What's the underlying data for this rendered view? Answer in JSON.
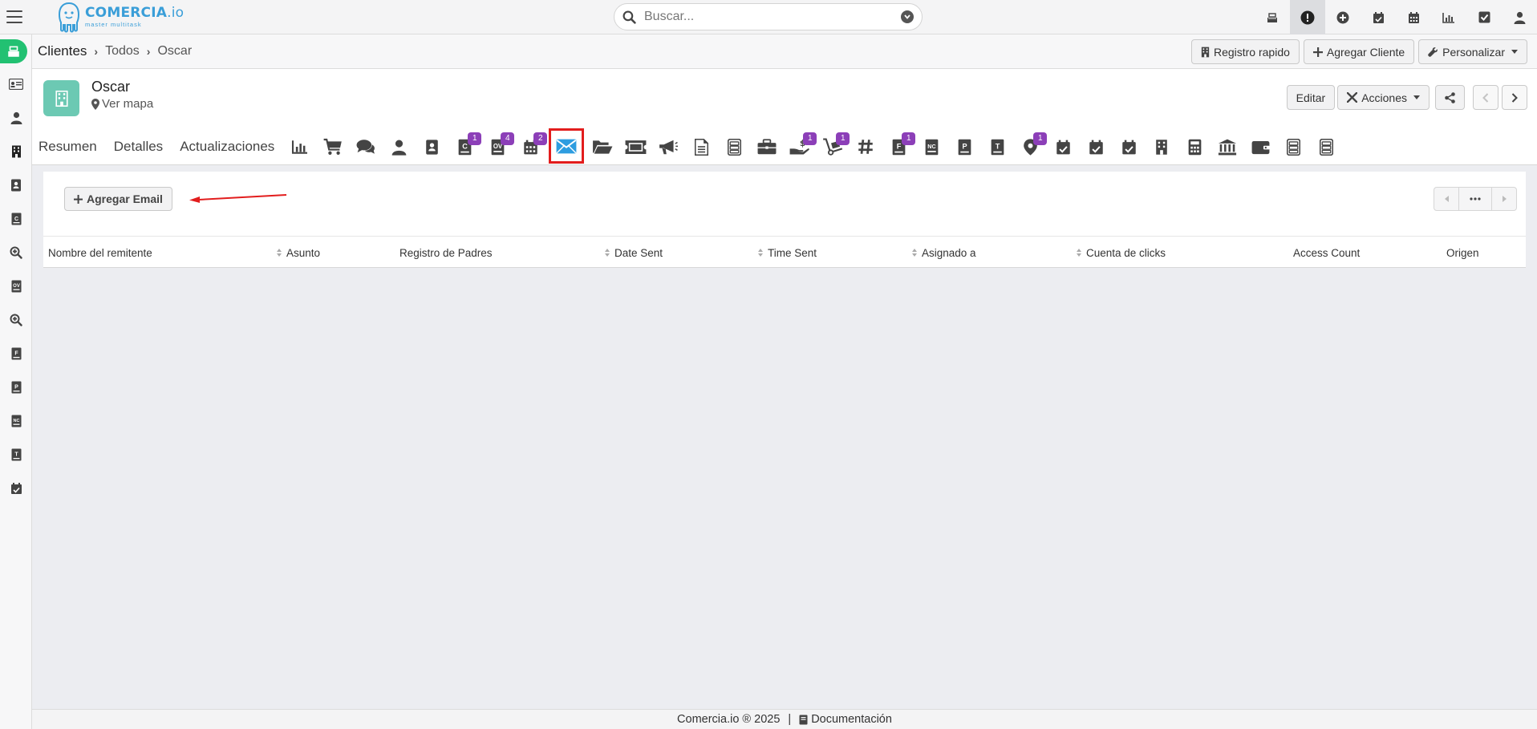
{
  "app": {
    "logo_name": "COMERCIA",
    "logo_ext": ".io",
    "logo_tagline": "master multitask"
  },
  "search": {
    "placeholder": "Buscar..."
  },
  "breadcrumb": {
    "level1": "Clientes",
    "level2": "Todos",
    "level3": "Oscar"
  },
  "header_actions": {
    "quick_register": "Registro rapido",
    "add_client": "Agregar Cliente",
    "customize": "Personalizar"
  },
  "record": {
    "name": "Oscar",
    "map_link": "Ver mapa",
    "edit": "Editar",
    "actions": "Acciones"
  },
  "tabs": {
    "summary": "Resumen",
    "details": "Detalles",
    "updates": "Actualizaciones"
  },
  "tab_icons": [
    {
      "icon": "bar-chart-icon",
      "badge": ""
    },
    {
      "icon": "cart-icon",
      "badge": ""
    },
    {
      "icon": "comments-icon",
      "badge": ""
    },
    {
      "icon": "user-icon",
      "badge": ""
    },
    {
      "icon": "contact-book-icon",
      "badge": ""
    },
    {
      "icon": "quote-doc-icon",
      "badge": "1"
    },
    {
      "icon": "order-doc-icon",
      "badge": "4"
    },
    {
      "icon": "calendar-icon",
      "badge": "2"
    },
    {
      "icon": "envelope-icon",
      "badge": ""
    },
    {
      "icon": "folder-open-icon",
      "badge": ""
    },
    {
      "icon": "ticket-icon",
      "badge": ""
    },
    {
      "icon": "megaphone-icon",
      "badge": ""
    },
    {
      "icon": "document-icon",
      "badge": ""
    },
    {
      "icon": "cabinet-icon",
      "badge": ""
    },
    {
      "icon": "briefcase-icon",
      "badge": ""
    },
    {
      "icon": "hand-money-icon",
      "badge": "1"
    },
    {
      "icon": "dolly-icon",
      "badge": "1"
    },
    {
      "icon": "hashtag-icon",
      "badge": ""
    },
    {
      "icon": "invoice-f-icon",
      "badge": "1"
    },
    {
      "icon": "credit-note-icon",
      "badge": ""
    },
    {
      "icon": "p-doc-icon",
      "badge": ""
    },
    {
      "icon": "t-doc-icon",
      "badge": ""
    },
    {
      "icon": "map-marker-icon",
      "badge": "1"
    },
    {
      "icon": "calendar-check-icon",
      "badge": ""
    },
    {
      "icon": "calendar-check-icon",
      "badge": ""
    },
    {
      "icon": "calendar-check-icon",
      "badge": ""
    },
    {
      "icon": "building-icon",
      "badge": ""
    },
    {
      "icon": "calculator-icon",
      "badge": ""
    },
    {
      "icon": "bank-icon",
      "badge": ""
    },
    {
      "icon": "wallet-icon",
      "badge": ""
    },
    {
      "icon": "cabinet-icon",
      "badge": ""
    },
    {
      "icon": "cabinet-icon",
      "badge": ""
    }
  ],
  "emails_panel": {
    "add_button": "Agregar Email",
    "columns": [
      "Nombre del remitente",
      "Asunto",
      "Registro de Padres",
      "Date Sent",
      "Time Sent",
      "Asignado a",
      "Cuenta de clicks",
      "Access Count",
      "Origen"
    ]
  },
  "footer": {
    "copyright": "Comercia.io ® 2025",
    "separator": "|",
    "docs": "Documentación"
  },
  "colors": {
    "accent_blue": "#3a9ed8",
    "badge_purple": "#8c3fb8",
    "highlight_red": "#e21d1d",
    "rail_green": "#22c172",
    "avatar_teal": "#6cc9b3"
  }
}
